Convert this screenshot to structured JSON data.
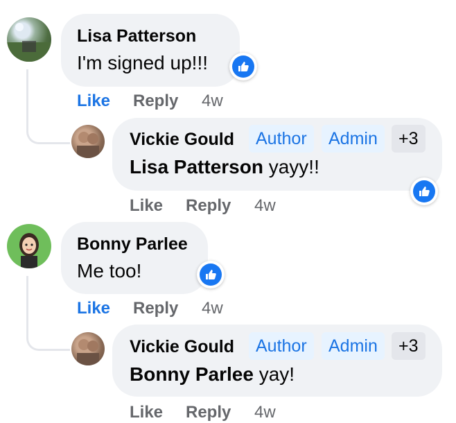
{
  "comments": [
    {
      "author": "Lisa Patterson",
      "text": "I'm signed up!!!",
      "actions": {
        "like": "Like",
        "reply": "Reply",
        "time": "4w"
      },
      "reply": {
        "author": "Vickie Gould",
        "badges": [
          "Author",
          "Admin",
          "+3"
        ],
        "mention": "Lisa Patterson",
        "text": " yayy!!",
        "actions": {
          "like": "Like",
          "reply": "Reply",
          "time": "4w"
        }
      }
    },
    {
      "author": "Bonny Parlee",
      "text": "Me too!",
      "actions": {
        "like": "Like",
        "reply": "Reply",
        "time": "4w"
      },
      "reply": {
        "author": "Vickie Gould",
        "badges": [
          "Author",
          "Admin",
          "+3"
        ],
        "mention": "Bonny Parlee",
        "text": " yay!",
        "actions": {
          "like": "Like",
          "reply": "Reply",
          "time": "4w"
        }
      }
    }
  ],
  "colors": {
    "accent": "#1b74e4",
    "bubble": "#f0f2f5",
    "muted": "#65676b",
    "like": "#1877f2"
  }
}
